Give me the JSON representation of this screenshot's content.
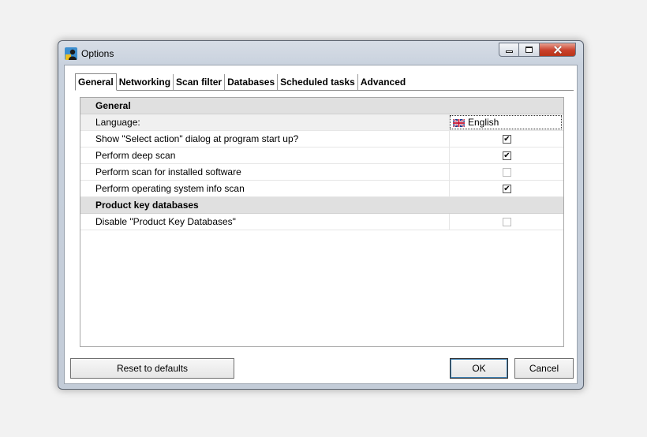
{
  "window": {
    "title": "Options",
    "icon": "key-user-app-icon"
  },
  "tabs": [
    {
      "label": "General",
      "active": true
    },
    {
      "label": "Networking",
      "active": false
    },
    {
      "label": "Scan filter",
      "active": false
    },
    {
      "label": "Databases",
      "active": false
    },
    {
      "label": "Scheduled tasks",
      "active": false
    },
    {
      "label": "Advanced",
      "active": false
    }
  ],
  "sections": {
    "general": {
      "title": "General",
      "language": {
        "label": "Language:",
        "value": "English",
        "icon": "uk-flag-icon"
      },
      "items": [
        {
          "label": "Show \"Select action\" dialog at program start up?",
          "checked": true
        },
        {
          "label": "Perform deep scan",
          "checked": true
        },
        {
          "label": "Perform scan for installed software",
          "checked": false
        },
        {
          "label": "Perform operating system info scan",
          "checked": true
        }
      ]
    },
    "product_key_databases": {
      "title": "Product key databases",
      "items": [
        {
          "label": "Disable \"Product Key Databases\"",
          "checked": false
        }
      ]
    }
  },
  "buttons": {
    "reset": "Reset to defaults",
    "ok": "OK",
    "cancel": "Cancel"
  },
  "check_glyph": "✔"
}
